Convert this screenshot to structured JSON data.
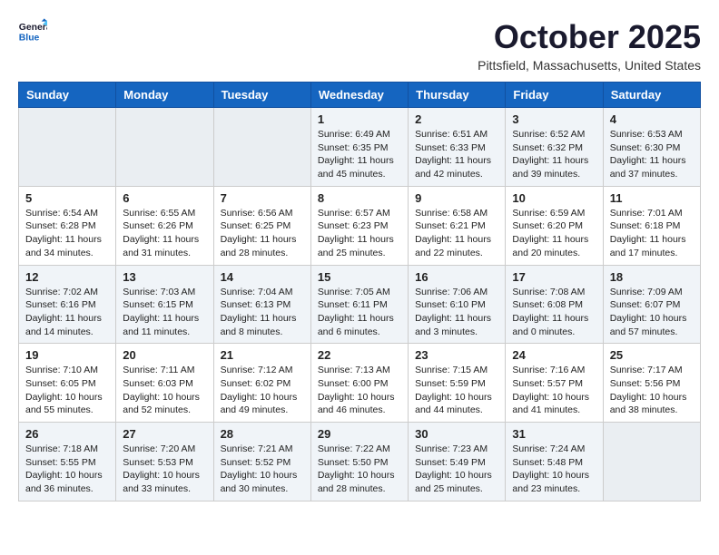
{
  "header": {
    "logo_general": "General",
    "logo_blue": "Blue",
    "month_title": "October 2025",
    "location": "Pittsfield, Massachusetts, United States"
  },
  "weekdays": [
    "Sunday",
    "Monday",
    "Tuesday",
    "Wednesday",
    "Thursday",
    "Friday",
    "Saturday"
  ],
  "weeks": [
    [
      {
        "day": "",
        "empty": true
      },
      {
        "day": "",
        "empty": true
      },
      {
        "day": "",
        "empty": true
      },
      {
        "day": "1",
        "sunrise": "6:49 AM",
        "sunset": "6:35 PM",
        "daylight": "11 hours and 45 minutes."
      },
      {
        "day": "2",
        "sunrise": "6:51 AM",
        "sunset": "6:33 PM",
        "daylight": "11 hours and 42 minutes."
      },
      {
        "day": "3",
        "sunrise": "6:52 AM",
        "sunset": "6:32 PM",
        "daylight": "11 hours and 39 minutes."
      },
      {
        "day": "4",
        "sunrise": "6:53 AM",
        "sunset": "6:30 PM",
        "daylight": "11 hours and 37 minutes."
      }
    ],
    [
      {
        "day": "5",
        "sunrise": "6:54 AM",
        "sunset": "6:28 PM",
        "daylight": "11 hours and 34 minutes."
      },
      {
        "day": "6",
        "sunrise": "6:55 AM",
        "sunset": "6:26 PM",
        "daylight": "11 hours and 31 minutes."
      },
      {
        "day": "7",
        "sunrise": "6:56 AM",
        "sunset": "6:25 PM",
        "daylight": "11 hours and 28 minutes."
      },
      {
        "day": "8",
        "sunrise": "6:57 AM",
        "sunset": "6:23 PM",
        "daylight": "11 hours and 25 minutes."
      },
      {
        "day": "9",
        "sunrise": "6:58 AM",
        "sunset": "6:21 PM",
        "daylight": "11 hours and 22 minutes."
      },
      {
        "day": "10",
        "sunrise": "6:59 AM",
        "sunset": "6:20 PM",
        "daylight": "11 hours and 20 minutes."
      },
      {
        "day": "11",
        "sunrise": "7:01 AM",
        "sunset": "6:18 PM",
        "daylight": "11 hours and 17 minutes."
      }
    ],
    [
      {
        "day": "12",
        "sunrise": "7:02 AM",
        "sunset": "6:16 PM",
        "daylight": "11 hours and 14 minutes."
      },
      {
        "day": "13",
        "sunrise": "7:03 AM",
        "sunset": "6:15 PM",
        "daylight": "11 hours and 11 minutes."
      },
      {
        "day": "14",
        "sunrise": "7:04 AM",
        "sunset": "6:13 PM",
        "daylight": "11 hours and 8 minutes."
      },
      {
        "day": "15",
        "sunrise": "7:05 AM",
        "sunset": "6:11 PM",
        "daylight": "11 hours and 6 minutes."
      },
      {
        "day": "16",
        "sunrise": "7:06 AM",
        "sunset": "6:10 PM",
        "daylight": "11 hours and 3 minutes."
      },
      {
        "day": "17",
        "sunrise": "7:08 AM",
        "sunset": "6:08 PM",
        "daylight": "11 hours and 0 minutes."
      },
      {
        "day": "18",
        "sunrise": "7:09 AM",
        "sunset": "6:07 PM",
        "daylight": "10 hours and 57 minutes."
      }
    ],
    [
      {
        "day": "19",
        "sunrise": "7:10 AM",
        "sunset": "6:05 PM",
        "daylight": "10 hours and 55 minutes."
      },
      {
        "day": "20",
        "sunrise": "7:11 AM",
        "sunset": "6:03 PM",
        "daylight": "10 hours and 52 minutes."
      },
      {
        "day": "21",
        "sunrise": "7:12 AM",
        "sunset": "6:02 PM",
        "daylight": "10 hours and 49 minutes."
      },
      {
        "day": "22",
        "sunrise": "7:13 AM",
        "sunset": "6:00 PM",
        "daylight": "10 hours and 46 minutes."
      },
      {
        "day": "23",
        "sunrise": "7:15 AM",
        "sunset": "5:59 PM",
        "daylight": "10 hours and 44 minutes."
      },
      {
        "day": "24",
        "sunrise": "7:16 AM",
        "sunset": "5:57 PM",
        "daylight": "10 hours and 41 minutes."
      },
      {
        "day": "25",
        "sunrise": "7:17 AM",
        "sunset": "5:56 PM",
        "daylight": "10 hours and 38 minutes."
      }
    ],
    [
      {
        "day": "26",
        "sunrise": "7:18 AM",
        "sunset": "5:55 PM",
        "daylight": "10 hours and 36 minutes."
      },
      {
        "day": "27",
        "sunrise": "7:20 AM",
        "sunset": "5:53 PM",
        "daylight": "10 hours and 33 minutes."
      },
      {
        "day": "28",
        "sunrise": "7:21 AM",
        "sunset": "5:52 PM",
        "daylight": "10 hours and 30 minutes."
      },
      {
        "day": "29",
        "sunrise": "7:22 AM",
        "sunset": "5:50 PM",
        "daylight": "10 hours and 28 minutes."
      },
      {
        "day": "30",
        "sunrise": "7:23 AM",
        "sunset": "5:49 PM",
        "daylight": "10 hours and 25 minutes."
      },
      {
        "day": "31",
        "sunrise": "7:24 AM",
        "sunset": "5:48 PM",
        "daylight": "10 hours and 23 minutes."
      },
      {
        "day": "",
        "empty": true
      }
    ]
  ],
  "labels": {
    "sunrise_label": "Sunrise:",
    "sunset_label": "Sunset:",
    "daylight_label": "Daylight:"
  }
}
